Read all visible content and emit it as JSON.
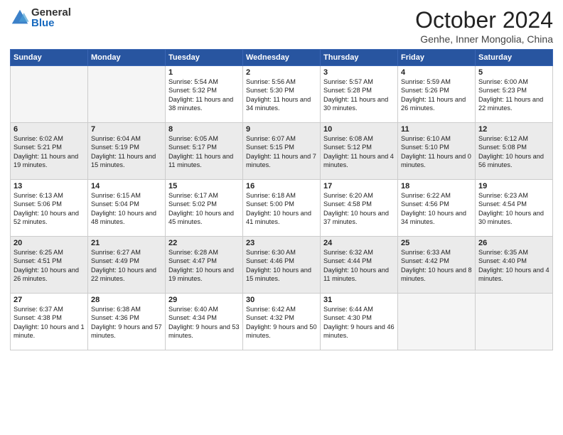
{
  "logo": {
    "general": "General",
    "blue": "Blue"
  },
  "header": {
    "month": "October 2024",
    "location": "Genhe, Inner Mongolia, China"
  },
  "weekdays": [
    "Sunday",
    "Monday",
    "Tuesday",
    "Wednesday",
    "Thursday",
    "Friday",
    "Saturday"
  ],
  "weeks": [
    [
      {
        "day": "",
        "sunrise": "",
        "sunset": "",
        "daylight": ""
      },
      {
        "day": "",
        "sunrise": "",
        "sunset": "",
        "daylight": ""
      },
      {
        "day": "1",
        "sunrise": "Sunrise: 5:54 AM",
        "sunset": "Sunset: 5:32 PM",
        "daylight": "Daylight: 11 hours and 38 minutes."
      },
      {
        "day": "2",
        "sunrise": "Sunrise: 5:56 AM",
        "sunset": "Sunset: 5:30 PM",
        "daylight": "Daylight: 11 hours and 34 minutes."
      },
      {
        "day": "3",
        "sunrise": "Sunrise: 5:57 AM",
        "sunset": "Sunset: 5:28 PM",
        "daylight": "Daylight: 11 hours and 30 minutes."
      },
      {
        "day": "4",
        "sunrise": "Sunrise: 5:59 AM",
        "sunset": "Sunset: 5:26 PM",
        "daylight": "Daylight: 11 hours and 26 minutes."
      },
      {
        "day": "5",
        "sunrise": "Sunrise: 6:00 AM",
        "sunset": "Sunset: 5:23 PM",
        "daylight": "Daylight: 11 hours and 22 minutes."
      }
    ],
    [
      {
        "day": "6",
        "sunrise": "Sunrise: 6:02 AM",
        "sunset": "Sunset: 5:21 PM",
        "daylight": "Daylight: 11 hours and 19 minutes."
      },
      {
        "day": "7",
        "sunrise": "Sunrise: 6:04 AM",
        "sunset": "Sunset: 5:19 PM",
        "daylight": "Daylight: 11 hours and 15 minutes."
      },
      {
        "day": "8",
        "sunrise": "Sunrise: 6:05 AM",
        "sunset": "Sunset: 5:17 PM",
        "daylight": "Daylight: 11 hours and 11 minutes."
      },
      {
        "day": "9",
        "sunrise": "Sunrise: 6:07 AM",
        "sunset": "Sunset: 5:15 PM",
        "daylight": "Daylight: 11 hours and 7 minutes."
      },
      {
        "day": "10",
        "sunrise": "Sunrise: 6:08 AM",
        "sunset": "Sunset: 5:12 PM",
        "daylight": "Daylight: 11 hours and 4 minutes."
      },
      {
        "day": "11",
        "sunrise": "Sunrise: 6:10 AM",
        "sunset": "Sunset: 5:10 PM",
        "daylight": "Daylight: 11 hours and 0 minutes."
      },
      {
        "day": "12",
        "sunrise": "Sunrise: 6:12 AM",
        "sunset": "Sunset: 5:08 PM",
        "daylight": "Daylight: 10 hours and 56 minutes."
      }
    ],
    [
      {
        "day": "13",
        "sunrise": "Sunrise: 6:13 AM",
        "sunset": "Sunset: 5:06 PM",
        "daylight": "Daylight: 10 hours and 52 minutes."
      },
      {
        "day": "14",
        "sunrise": "Sunrise: 6:15 AM",
        "sunset": "Sunset: 5:04 PM",
        "daylight": "Daylight: 10 hours and 48 minutes."
      },
      {
        "day": "15",
        "sunrise": "Sunrise: 6:17 AM",
        "sunset": "Sunset: 5:02 PM",
        "daylight": "Daylight: 10 hours and 45 minutes."
      },
      {
        "day": "16",
        "sunrise": "Sunrise: 6:18 AM",
        "sunset": "Sunset: 5:00 PM",
        "daylight": "Daylight: 10 hours and 41 minutes."
      },
      {
        "day": "17",
        "sunrise": "Sunrise: 6:20 AM",
        "sunset": "Sunset: 4:58 PM",
        "daylight": "Daylight: 10 hours and 37 minutes."
      },
      {
        "day": "18",
        "sunrise": "Sunrise: 6:22 AM",
        "sunset": "Sunset: 4:56 PM",
        "daylight": "Daylight: 10 hours and 34 minutes."
      },
      {
        "day": "19",
        "sunrise": "Sunrise: 6:23 AM",
        "sunset": "Sunset: 4:54 PM",
        "daylight": "Daylight: 10 hours and 30 minutes."
      }
    ],
    [
      {
        "day": "20",
        "sunrise": "Sunrise: 6:25 AM",
        "sunset": "Sunset: 4:51 PM",
        "daylight": "Daylight: 10 hours and 26 minutes."
      },
      {
        "day": "21",
        "sunrise": "Sunrise: 6:27 AM",
        "sunset": "Sunset: 4:49 PM",
        "daylight": "Daylight: 10 hours and 22 minutes."
      },
      {
        "day": "22",
        "sunrise": "Sunrise: 6:28 AM",
        "sunset": "Sunset: 4:47 PM",
        "daylight": "Daylight: 10 hours and 19 minutes."
      },
      {
        "day": "23",
        "sunrise": "Sunrise: 6:30 AM",
        "sunset": "Sunset: 4:46 PM",
        "daylight": "Daylight: 10 hours and 15 minutes."
      },
      {
        "day": "24",
        "sunrise": "Sunrise: 6:32 AM",
        "sunset": "Sunset: 4:44 PM",
        "daylight": "Daylight: 10 hours and 11 minutes."
      },
      {
        "day": "25",
        "sunrise": "Sunrise: 6:33 AM",
        "sunset": "Sunset: 4:42 PM",
        "daylight": "Daylight: 10 hours and 8 minutes."
      },
      {
        "day": "26",
        "sunrise": "Sunrise: 6:35 AM",
        "sunset": "Sunset: 4:40 PM",
        "daylight": "Daylight: 10 hours and 4 minutes."
      }
    ],
    [
      {
        "day": "27",
        "sunrise": "Sunrise: 6:37 AM",
        "sunset": "Sunset: 4:38 PM",
        "daylight": "Daylight: 10 hours and 1 minute."
      },
      {
        "day": "28",
        "sunrise": "Sunrise: 6:38 AM",
        "sunset": "Sunset: 4:36 PM",
        "daylight": "Daylight: 9 hours and 57 minutes."
      },
      {
        "day": "29",
        "sunrise": "Sunrise: 6:40 AM",
        "sunset": "Sunset: 4:34 PM",
        "daylight": "Daylight: 9 hours and 53 minutes."
      },
      {
        "day": "30",
        "sunrise": "Sunrise: 6:42 AM",
        "sunset": "Sunset: 4:32 PM",
        "daylight": "Daylight: 9 hours and 50 minutes."
      },
      {
        "day": "31",
        "sunrise": "Sunrise: 6:44 AM",
        "sunset": "Sunset: 4:30 PM",
        "daylight": "Daylight: 9 hours and 46 minutes."
      },
      {
        "day": "",
        "sunrise": "",
        "sunset": "",
        "daylight": ""
      },
      {
        "day": "",
        "sunrise": "",
        "sunset": "",
        "daylight": ""
      }
    ]
  ]
}
